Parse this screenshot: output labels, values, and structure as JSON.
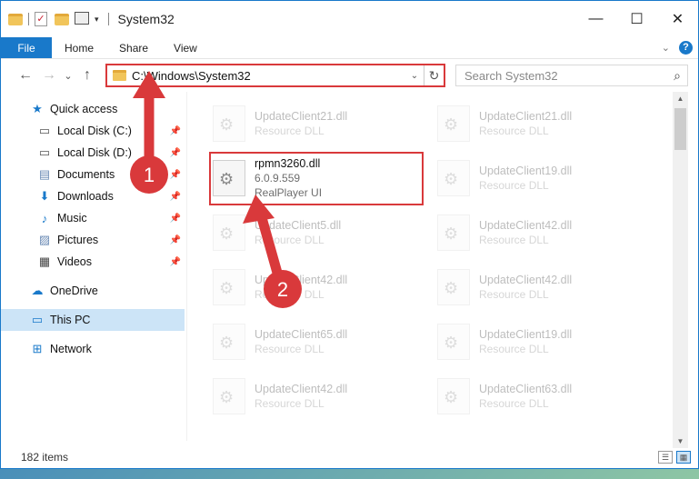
{
  "window": {
    "title": "System32",
    "controls": {
      "minimize": "—",
      "maximize": "☐",
      "close": "✕"
    }
  },
  "ribbon": {
    "tabs": [
      "File",
      "Home",
      "Share",
      "View"
    ],
    "expand_icon": "chevron-down-icon",
    "help": "?"
  },
  "nav": {
    "back": "←",
    "forward": "→",
    "recent": "⌄",
    "up": "↑",
    "address": "C:\\Windows\\System32",
    "address_dropdown": "⌄",
    "refresh": "↻",
    "search_placeholder": "Search System32",
    "search_icon": "⌕"
  },
  "sidebar": {
    "items": [
      {
        "label": "Quick access",
        "icon": "★",
        "color": "#1979ca",
        "pinned": false
      },
      {
        "label": "Local Disk (C:)",
        "icon": "▭",
        "color": "#555555",
        "pinned": true
      },
      {
        "label": "Local Disk (D:)",
        "icon": "▭",
        "color": "#555555",
        "pinned": true
      },
      {
        "label": "Documents",
        "icon": "▤",
        "color": "#6b8bb5",
        "pinned": true
      },
      {
        "label": "Downloads",
        "icon": "⬇",
        "color": "#1979ca",
        "pinned": true
      },
      {
        "label": "Music",
        "icon": "♪",
        "color": "#1979ca",
        "pinned": true
      },
      {
        "label": "Pictures",
        "icon": "▨",
        "color": "#6b8bb5",
        "pinned": true
      },
      {
        "label": "Videos",
        "icon": "▦",
        "color": "#444444",
        "pinned": true
      },
      {
        "label": "OneDrive",
        "icon": "☁",
        "color": "#1979ca",
        "pinned": false
      },
      {
        "label": "This PC",
        "icon": "▭",
        "color": "#1979ca",
        "pinned": false
      },
      {
        "label": "Network",
        "icon": "⊞",
        "color": "#1979ca",
        "pinned": false
      }
    ],
    "pin_glyph": "📌"
  },
  "files": {
    "highlighted": {
      "name": "rpmn3260.dll",
      "version": "6.0.9.559",
      "description": "RealPlayer UI"
    },
    "left_column": [
      {
        "name": "UpdateClient21.dll",
        "sub": "Resource DLL"
      },
      {
        "name": "UpdateClient5.dll",
        "sub": "Resource DLL"
      },
      {
        "name": "UpdateClient42.dll",
        "sub": "Resource DLL"
      },
      {
        "name": "UpdateClient65.dll",
        "sub": "Resource DLL"
      },
      {
        "name": "UpdateClient42.dll",
        "sub": "Resource DLL"
      }
    ],
    "right_column": [
      {
        "name": "UpdateClient21.dll",
        "sub": "Resource DLL"
      },
      {
        "name": "UpdateClient19.dll",
        "sub": "Resource DLL"
      },
      {
        "name": "UpdateClient42.dll",
        "sub": "Resource DLL"
      },
      {
        "name": "UpdateClient42.dll",
        "sub": "Resource DLL"
      },
      {
        "name": "UpdateClient19.dll",
        "sub": "Resource DLL"
      },
      {
        "name": "UpdateClient63.dll",
        "sub": "Resource DLL"
      }
    ]
  },
  "status": {
    "count": "182 items"
  },
  "annotations": {
    "step1": "1",
    "step2": "2",
    "color": "#d9393b"
  },
  "colors": {
    "accent": "#1979ca",
    "highlight_border": "#d9393b",
    "selected_bg": "#cce4f7"
  }
}
